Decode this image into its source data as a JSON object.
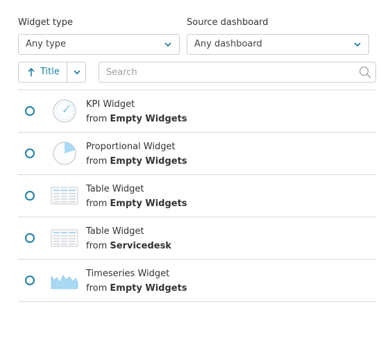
{
  "filters": {
    "widget_type_label": "Widget type",
    "widget_type_value": "Any type",
    "source_dashboard_label": "Source dashboard",
    "source_dashboard_value": "Any dashboard"
  },
  "sort": {
    "label": "Title",
    "direction": "ascending"
  },
  "search": {
    "placeholder": "Search",
    "value": ""
  },
  "colors": {
    "accent": "#1f7fa6",
    "border": "#c9ced3",
    "divider": "#d8dbdf",
    "thumb_fill": "#a9d9f3"
  },
  "widgets": [
    {
      "title": "KPI Widget",
      "from_label": "from",
      "source": "Empty Widgets",
      "icon": "kpi-gauge-icon"
    },
    {
      "title": "Proportional Widget",
      "from_label": "from",
      "source": "Empty Widgets",
      "icon": "pie-chart-icon"
    },
    {
      "title": "Table Widget",
      "from_label": "from",
      "source": "Empty Widgets",
      "icon": "table-icon"
    },
    {
      "title": "Table Widget",
      "from_label": "from",
      "source": "Servicedesk",
      "icon": "table-icon"
    },
    {
      "title": "Timeseries Widget",
      "from_label": "from",
      "source": "Empty Widgets",
      "icon": "area-chart-icon"
    }
  ]
}
